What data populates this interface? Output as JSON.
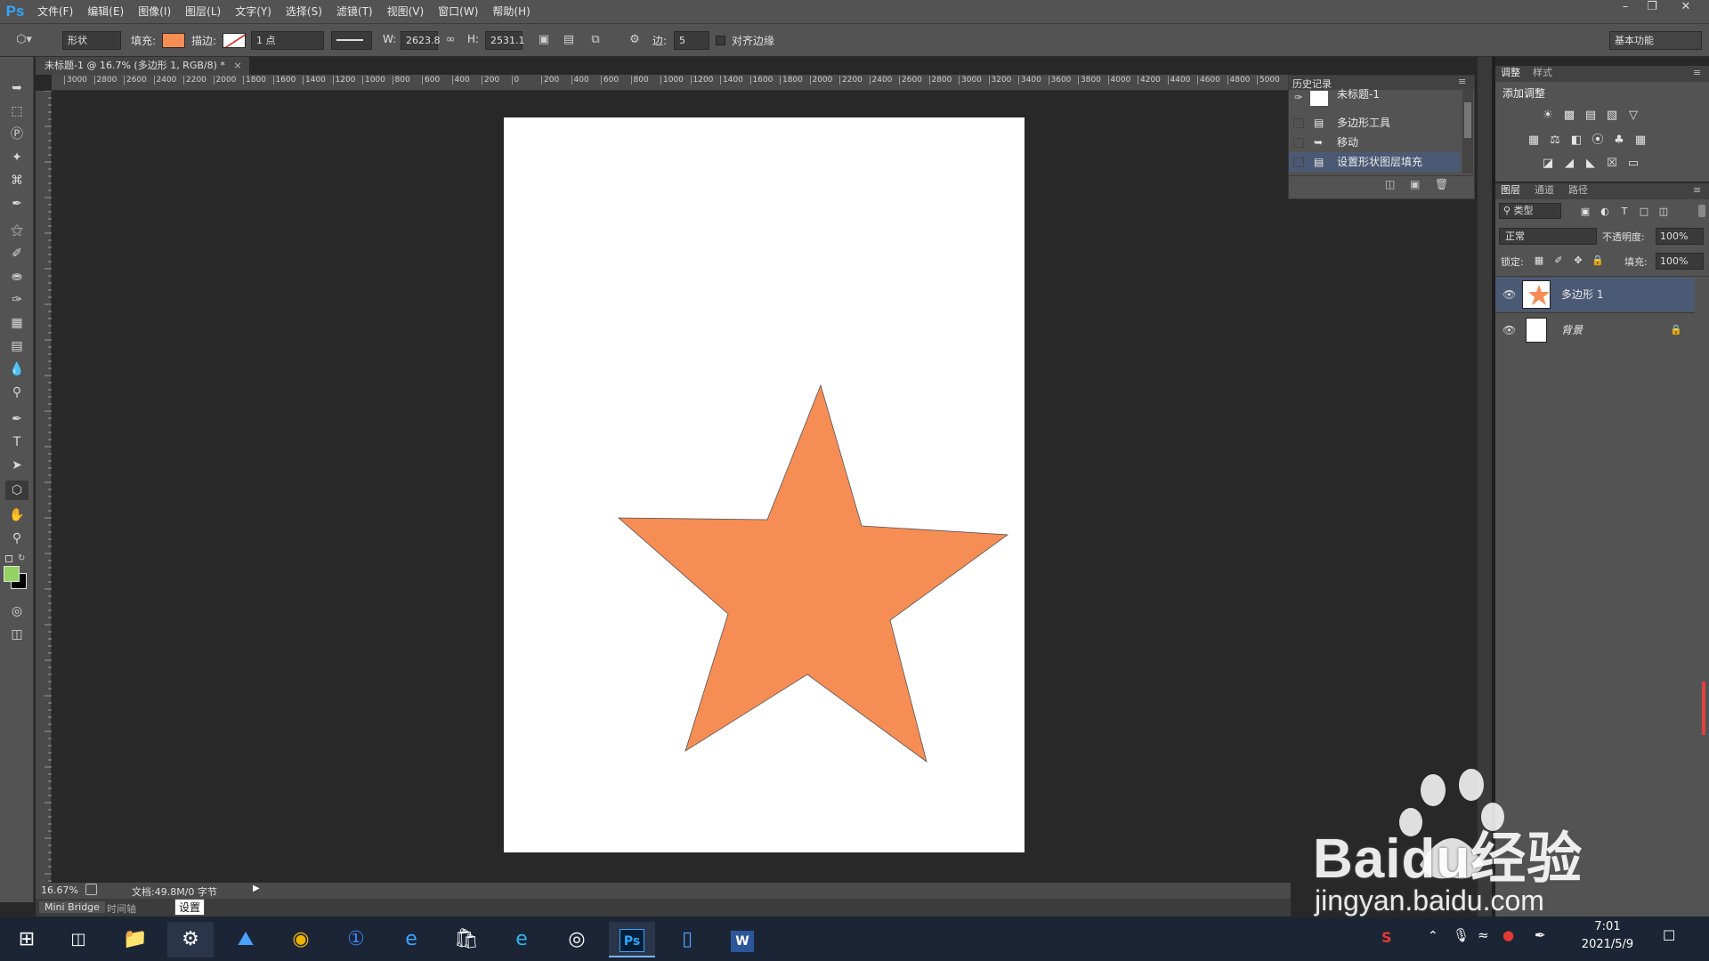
{
  "menubar": {
    "logo": "Ps",
    "items": [
      "文件(F)",
      "编辑(E)",
      "图像(I)",
      "图层(L)",
      "文字(Y)",
      "选择(S)",
      "滤镜(T)",
      "视图(V)",
      "窗口(W)",
      "帮助(H)"
    ]
  },
  "options": {
    "mode": "形状",
    "fill_label": "填充:",
    "stroke_label": "描边:",
    "stroke_width": "1 点",
    "w_label": "W:",
    "w_value": "2623.8",
    "h_label": "H:",
    "h_value": "2531.1",
    "sides_label": "边:",
    "sides_value": "5",
    "align_edges": "对齐边缘",
    "workspace": "基本功能",
    "fill_color": "#f68d55"
  },
  "document": {
    "tab_title": "未标题-1 @ 16.7% (多边形 1, RGB/8) *",
    "zoom": "16.67%",
    "doc_info": "文档:49.8M/0 字节",
    "tooltip": "设置",
    "ruler_labels": [
      "3000",
      "2800",
      "2600",
      "2400",
      "2200",
      "2000",
      "1800",
      "1600",
      "1400",
      "1200",
      "1000",
      "800",
      "600",
      "400",
      "200",
      "0",
      "200",
      "400",
      "600",
      "800",
      "1000",
      "1200",
      "1400",
      "1600",
      "1800",
      "2000",
      "2200",
      "2400",
      "2600",
      "2800",
      "3000",
      "3200",
      "3400",
      "3600",
      "3800",
      "4000",
      "4200",
      "4400",
      "4600",
      "4800",
      "5000"
    ],
    "shape_color": "#f68d55"
  },
  "bottom_tabs": [
    "Mini Bridge",
    "时间轴"
  ],
  "history": {
    "title": "历史记录",
    "snapshot": "未标题-1",
    "items": [
      "多边形工具",
      "移动",
      "设置形状图层填充"
    ]
  },
  "adjust": {
    "tabs": [
      "调整",
      "样式"
    ],
    "title": "添加调整"
  },
  "layers": {
    "tabs": [
      "图层",
      "通道",
      "路径"
    ],
    "filter": "类型",
    "blend_mode": "正常",
    "opacity_label": "不透明度:",
    "opacity": "100%",
    "lock_label": "锁定:",
    "fill_label": "填充:",
    "fill": "100%",
    "items": [
      {
        "name": "多边形 1",
        "selected": true
      },
      {
        "name": "背景",
        "selected": false
      }
    ]
  },
  "taskbar": {
    "time": "7:01",
    "date": "2021/5/9"
  },
  "watermark": {
    "brand": "Baidu经验",
    "url": "jingyan.baidu.com"
  }
}
